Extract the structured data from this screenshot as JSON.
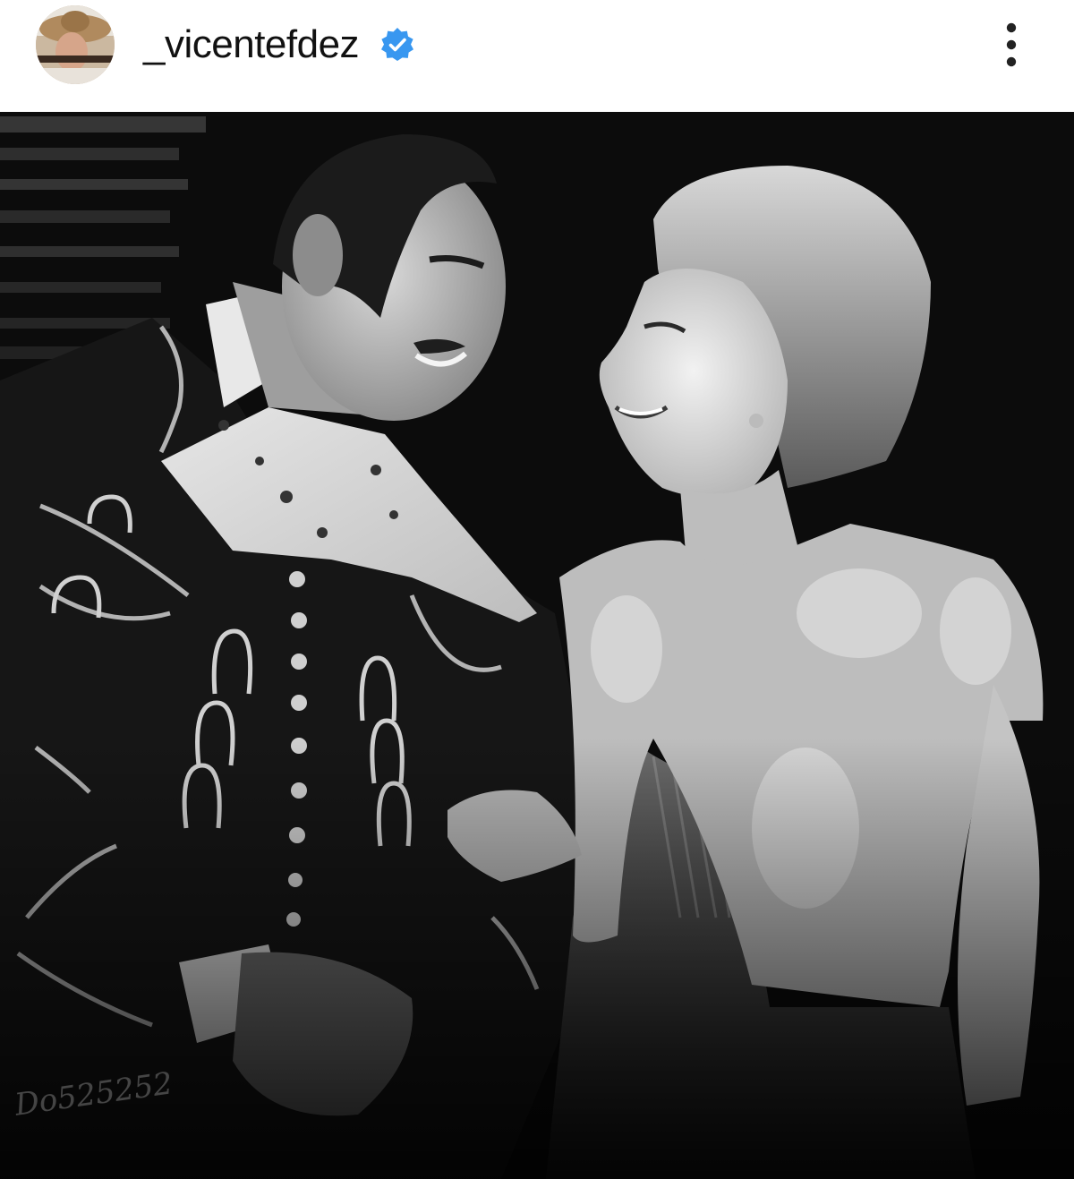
{
  "post": {
    "username": "_vicentefdez",
    "verified": true,
    "avatar_icon": "profile-avatar",
    "verified_icon": "verified-badge-icon",
    "more_icon": "more-options-icon",
    "accent_color": "#3897f0",
    "photo": {
      "style": "black-and-white",
      "watermark": "Do525252"
    }
  }
}
